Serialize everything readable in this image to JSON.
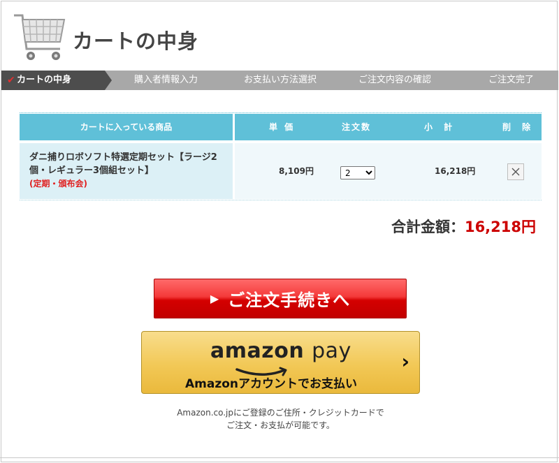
{
  "header": {
    "title": "カートの中身"
  },
  "steps": [
    {
      "label": "カートの中身",
      "active": true
    },
    {
      "label": "購入者情報入力",
      "active": false
    },
    {
      "label": "お支払い方法選択",
      "active": false
    },
    {
      "label": "ご注文内容の確認",
      "active": false
    },
    {
      "label": "ご注文完了",
      "active": false
    }
  ],
  "table": {
    "headers": {
      "product": "カートに入っている商品",
      "price": "単 価",
      "qty": "注文数",
      "subtotal": "小 計",
      "delete": "削 除"
    },
    "rows": [
      {
        "name": "ダニ捕りロボソフト特選定期セット【ラージ2個・レギュラー3個組セット】",
        "tag": "(定期・頒布会)",
        "unit_price": "8,109円",
        "qty": "2",
        "subtotal": "16,218円"
      }
    ]
  },
  "total": {
    "label": "合計金額：",
    "amount": "16,218円"
  },
  "checkout": {
    "label": "ご注文手続きへ"
  },
  "amazon": {
    "logo_amazon": "amazon",
    "logo_pay": "pay",
    "sub": "Amazonアカウントでお支払い",
    "note_line1": "Amazon.co.jpにご登録のご住所・クレジットカードで",
    "note_line2": "ご注文・お支払が可能です。"
  },
  "colors": {
    "table_header": "#5fc0d8",
    "step_active": "#4d4d4d",
    "step_bar": "#a8a8a8",
    "total_amount": "#cc0000",
    "checkout_red": "#d40000"
  }
}
